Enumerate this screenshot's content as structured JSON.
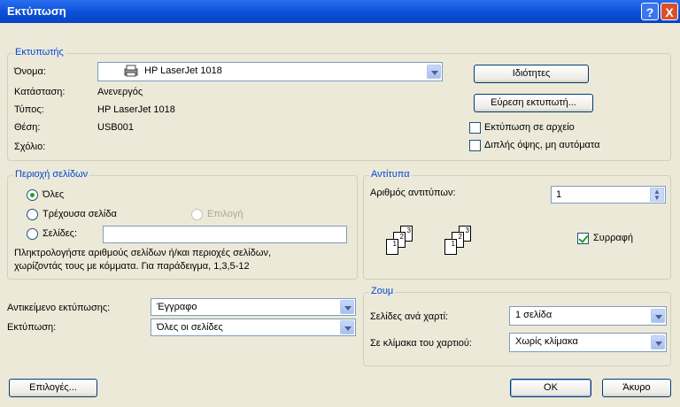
{
  "window": {
    "title": "Εκτύπωση",
    "help": "?",
    "close": "X"
  },
  "printer": {
    "group_label": "Εκτυπωτής",
    "name_label": "Όνομα:",
    "name_value": "HP LaserJet 1018",
    "status_label": "Κατάσταση:",
    "status_value": "Ανενεργός",
    "type_label": "Τύπος:",
    "type_value": "HP LaserJet 1018",
    "where_label": "Θέση:",
    "where_value": "USB001",
    "comment_label": "Σχόλιο:",
    "properties_button": "Ιδιότητες",
    "find_button": "Εύρεση εκτυπωτή...",
    "print_to_file": "Εκτύπωση σε αρχείο",
    "duplex": "Διπλής όψης, μη αυτόματα",
    "print_to_file_checked": false,
    "duplex_checked": false
  },
  "page_range": {
    "group_label": "Περιοχή σελίδων",
    "all": "Όλες",
    "current": "Τρέχουσα σελίδα",
    "selection": "Επιλογή",
    "pages": "Σελίδες:",
    "pages_value": "",
    "selected": "all",
    "hint_line1": "Πληκτρολογήστε αριθμούς σελίδων ή/και περιοχές σελίδων,",
    "hint_line2": "χωρίζοντάς τους με κόμματα. Για παράδειγμα, 1,3,5-12"
  },
  "copies": {
    "group_label": "Αντίτυπα",
    "count_label": "Αριθμός αντιτύπων:",
    "count_value": "1",
    "collate": "Συρραφή",
    "collate_checked": true,
    "stack_pages": [
      "3",
      "2",
      "1"
    ]
  },
  "print_what": {
    "label": "Αντικείμενο εκτύπωσης:",
    "value": "Έγγραφο",
    "print_label": "Εκτύπωση:",
    "print_value": "Όλες οι σελίδες"
  },
  "zoom": {
    "group_label": "Ζουμ",
    "pages_per_sheet_label": "Σελίδες ανά χαρτί:",
    "pages_per_sheet_value": "1 σελίδα",
    "scale_label": "Σε κλίμακα του χαρτιού:",
    "scale_value": "Χωρίς κλίμακα"
  },
  "footer": {
    "options": "Επιλογές...",
    "ok": "OK",
    "cancel": "Άκυρο"
  }
}
